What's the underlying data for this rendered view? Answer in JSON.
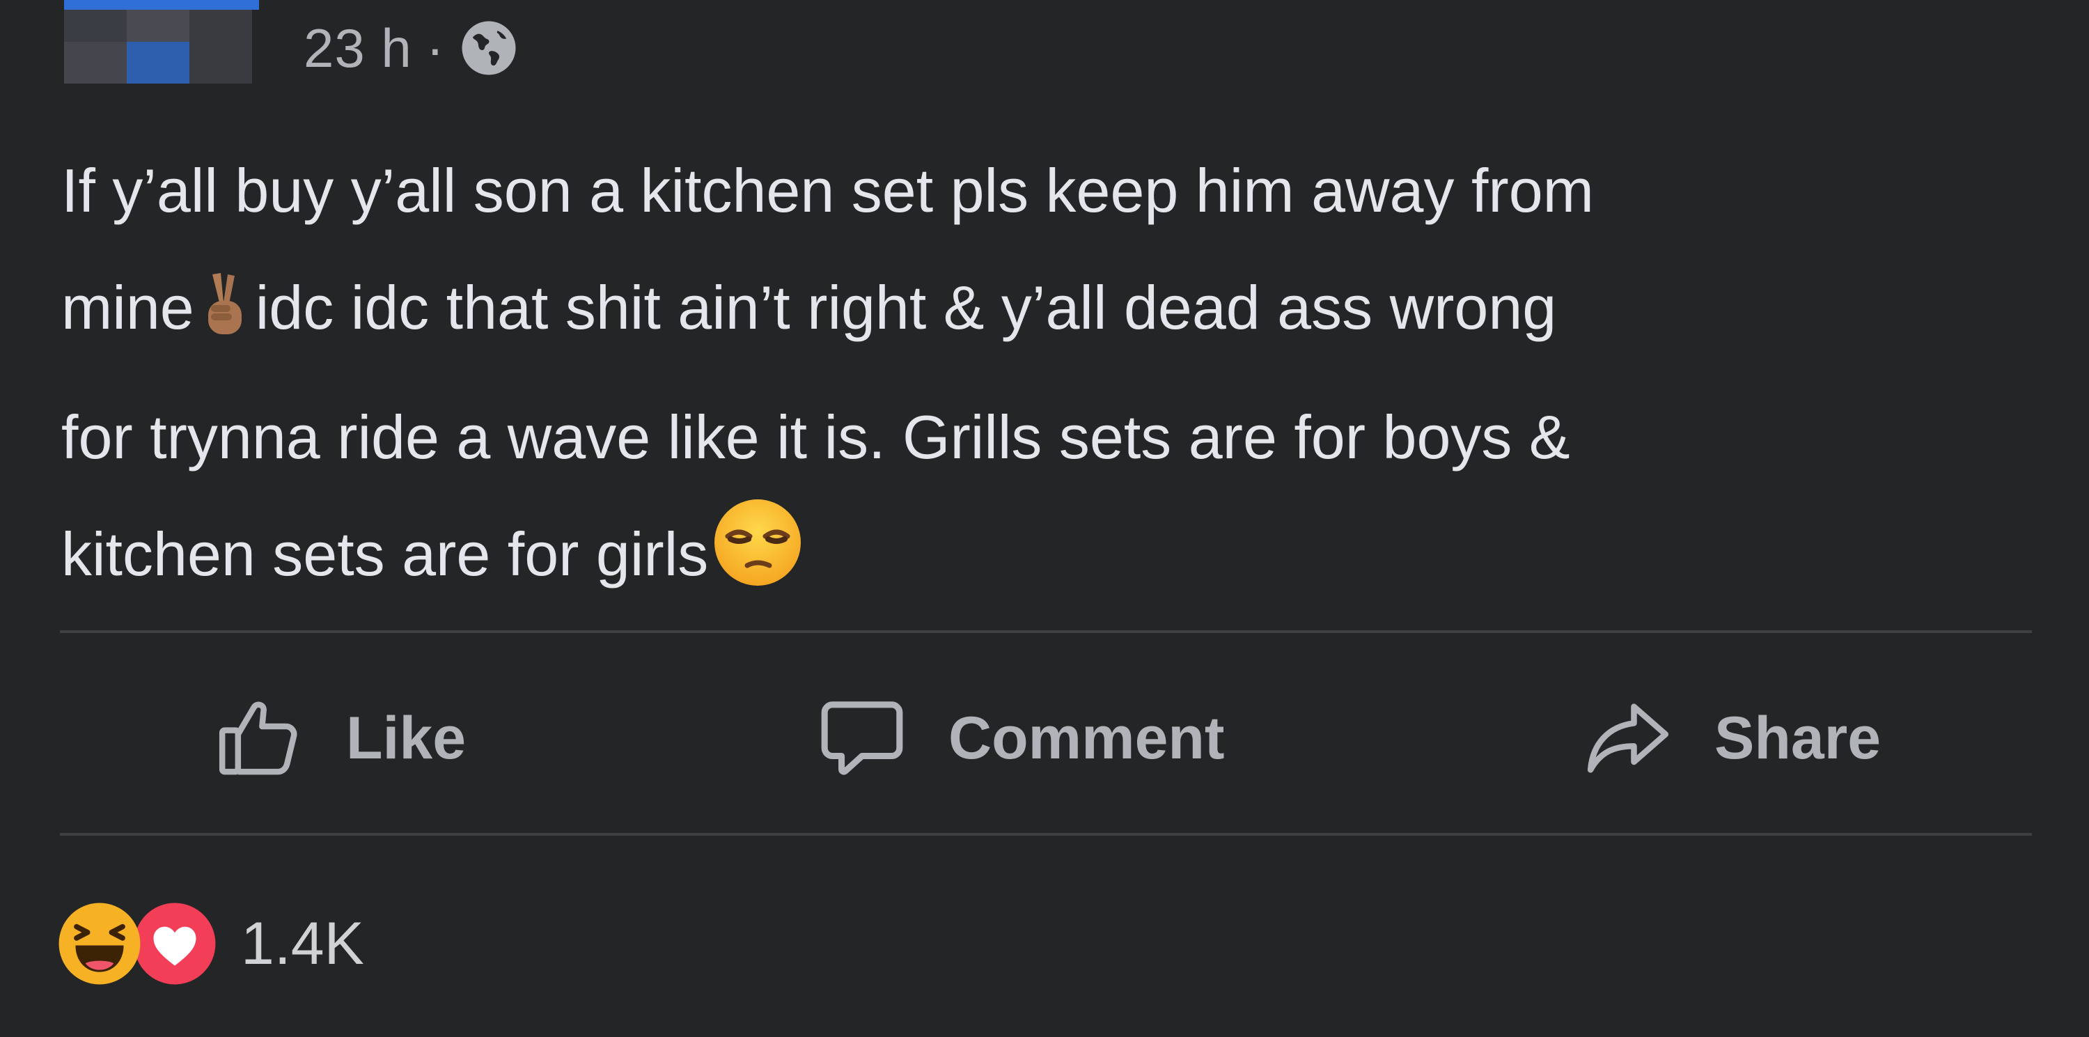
{
  "post": {
    "time": "23 h",
    "separator": "·",
    "audience_icon": "globe-icon",
    "text_lines": [
      "If y’all buy y’all son a kitchen set pls keep him away from",
      "mine",
      "idc idc that shit ain’t right & y’all dead ass wrong",
      "for trynna ride a wave like it is. Grills sets are for boys &",
      "kitchen sets are for girls"
    ],
    "emojis": [
      "victory-hand-emoji",
      "unamused-face-emoji"
    ]
  },
  "actions": {
    "like_label": "Like",
    "comment_label": "Comment",
    "share_label": "Share"
  },
  "reactions": {
    "icons": [
      "haha-reaction-icon",
      "love-reaction-icon"
    ],
    "count": "1.4K"
  },
  "colors": {
    "background": "#242526",
    "text": "#e4e6eb",
    "secondary_text": "#b0b3b8",
    "divider": "#3e4042",
    "love": "#f33e58",
    "haha": "#f7b125"
  }
}
